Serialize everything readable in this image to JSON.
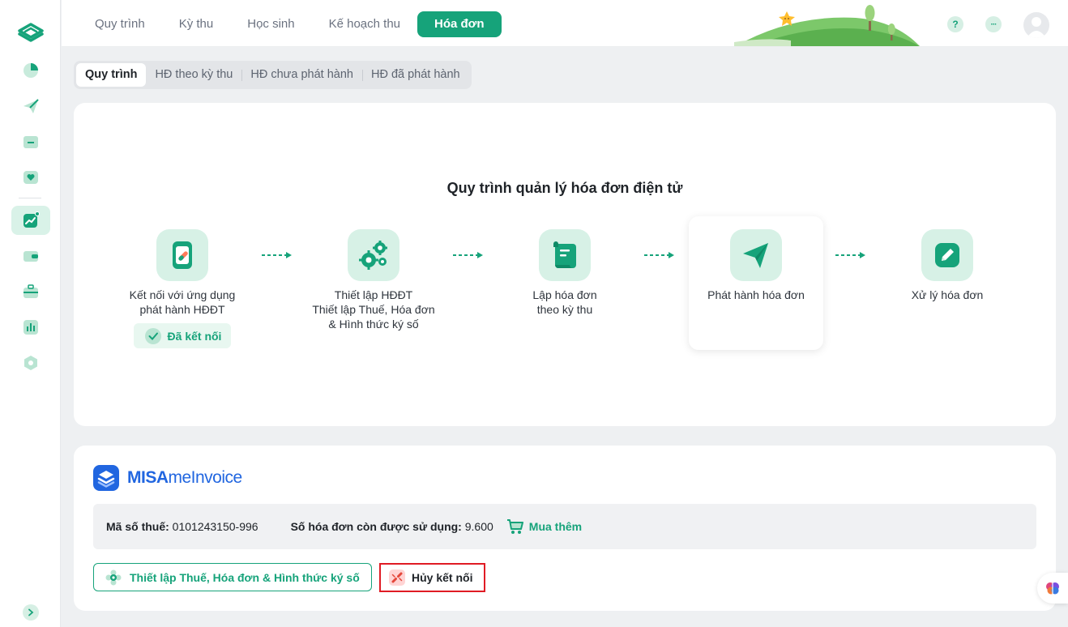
{
  "topnav": {
    "tabs": [
      {
        "label": "Quy trình",
        "active": false
      },
      {
        "label": "Kỳ thu",
        "active": false
      },
      {
        "label": "Học sinh",
        "active": false
      },
      {
        "label": "Kế hoạch thu",
        "active": false
      },
      {
        "label": "Hóa đơn",
        "active": true
      }
    ],
    "help_label": "?",
    "more_label": "···"
  },
  "subtabs": [
    {
      "label": "Quy trình",
      "active": true
    },
    {
      "label": "HĐ theo kỳ thu",
      "active": false
    },
    {
      "label": "HĐ chưa phát hành",
      "active": false
    },
    {
      "label": "HĐ đã phát hành",
      "active": false
    }
  ],
  "process": {
    "title": "Quy trình quản lý hóa đơn điện tử",
    "steps": [
      {
        "label": "Kết nối với ứng dụng\nphát hành HĐĐT",
        "icon": "link-phone-icon",
        "status": "Đã kết nối"
      },
      {
        "label": "Thiết lập HĐĐT\nThiết lập Thuế, Hóa đơn\n& Hình thức ký số",
        "icon": "gears-icon"
      },
      {
        "label": "Lập hóa đơn\ntheo kỳ thu",
        "icon": "scroll-icon"
      },
      {
        "label": "Phát hành hóa đơn",
        "icon": "paper-plane-icon",
        "highlighted": true
      },
      {
        "label": "Xử lý hóa đơn",
        "icon": "edit-icon"
      }
    ]
  },
  "invoice": {
    "brand_bold": "MISA",
    "brand_thin": "meInvoice",
    "tax_label": "Mã số thuế:",
    "tax_value": "0101243150-996",
    "remaining_label": "Số hóa đơn còn được sử dụng:",
    "remaining_value": "9.600",
    "buy_label": "Mua thêm",
    "setup_button": "Thiết lập Thuế, Hóa đơn & Hình thức ký số",
    "cancel_button": "Hủy kết nối"
  },
  "colors": {
    "accent": "#16a37a",
    "accent_light": "#d7f1e6",
    "brand_blue": "#2166e0",
    "danger_border": "#e01b24"
  }
}
